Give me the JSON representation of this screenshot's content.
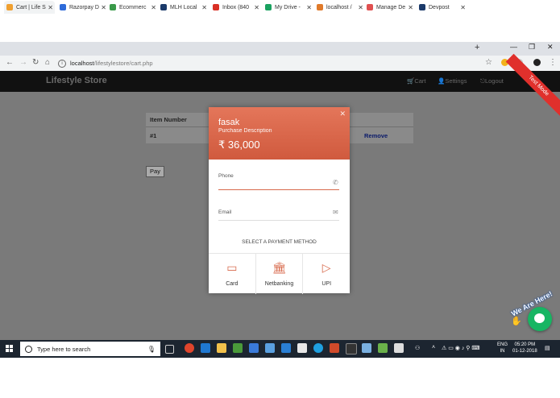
{
  "browser": {
    "tabs": [
      {
        "label": "Cart | Life S",
        "color": "#f0a030"
      },
      {
        "label": "Razorpay D",
        "color": "#2e6bd9"
      },
      {
        "label": "Ecommerc",
        "color": "#3a9a4a"
      },
      {
        "label": "MLH Local",
        "color": "#1b3a6a"
      },
      {
        "label": "Inbox (840",
        "color": "#d93025"
      },
      {
        "label": "My Drive -",
        "color": "#1aa260"
      },
      {
        "label": "localhost /",
        "color": "#e07a2a"
      },
      {
        "label": "Manage De",
        "color": "#e05050"
      },
      {
        "label": "Devpost",
        "color": "#1b3a6a"
      }
    ],
    "new_tab_label": "+",
    "url_host": "localhost",
    "url_path": "/lifestylestore/cart.php",
    "controls": {
      "minimize": "—",
      "restore": "❐",
      "close": "✕"
    }
  },
  "site": {
    "brand": "Lifestyle Store",
    "nav": {
      "cart": "Cart",
      "settings": "Settings",
      "logout": "Logout"
    },
    "ribbon": "Test Mode",
    "table_header": "Item Number",
    "row_number": "#1",
    "remove_label": "Remove",
    "pay_label": "Pay"
  },
  "checkout": {
    "merchant": "fasak",
    "description": "Purchase Description",
    "amount": "₹ 36,000",
    "phone_label": "Phone",
    "email_label": "Email",
    "section_title": "SELECT A PAYMENT METHOD",
    "methods": [
      {
        "label": "Card",
        "icon": "card-icon"
      },
      {
        "label": "Netbanking",
        "icon": "bank-icon"
      },
      {
        "label": "UPI",
        "icon": "upi-icon"
      }
    ],
    "accent_color": "#d86a4c"
  },
  "chat_widget": {
    "label": "We Are Here!",
    "color": "#17b563"
  },
  "taskbar": {
    "search_placeholder": "Type here to search",
    "lang_line1": "ENG",
    "lang_line2": "IN",
    "time": "05:20 PM",
    "date": "01-12-2018"
  }
}
